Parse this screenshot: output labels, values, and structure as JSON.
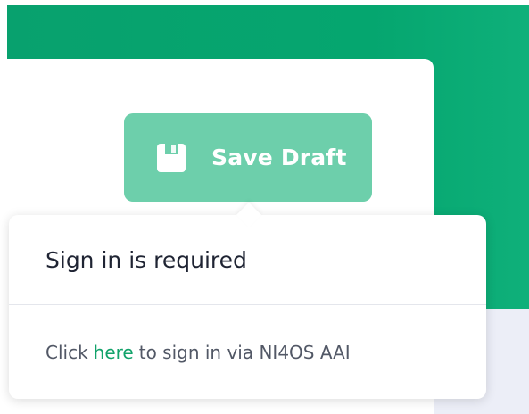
{
  "colors": {
    "accent_green": "#08a16e",
    "button_green": "#6dcfab",
    "link_green": "#11a26a"
  },
  "toolbar": {
    "save_draft_label": "Save Draft",
    "save_draft_icon": "floppy-disk-icon"
  },
  "popover": {
    "title": "Sign in is required",
    "body_prefix": "Click",
    "link_text": "here",
    "body_suffix": "to sign in via NI4OS AAI"
  }
}
